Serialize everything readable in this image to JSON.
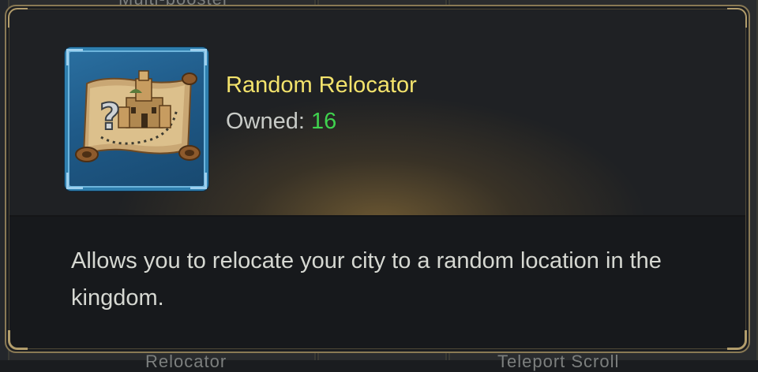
{
  "background": {
    "top_partial_label": "Multi-booster",
    "bottom_partial_labels": [
      "Relocator",
      "Teleport Scroll"
    ]
  },
  "item": {
    "icon": "treasure-map-city-question-icon",
    "title": "Random Relocator",
    "owned_label": "Owned: ",
    "owned_count": "16",
    "description": "Allows you to relocate your city to a random location in the kingdom."
  },
  "colors": {
    "title": "#f3e36c",
    "owned_count": "#3fd24e",
    "frame_blue": "#2f7fae",
    "border_gold": "#8a7a55"
  }
}
